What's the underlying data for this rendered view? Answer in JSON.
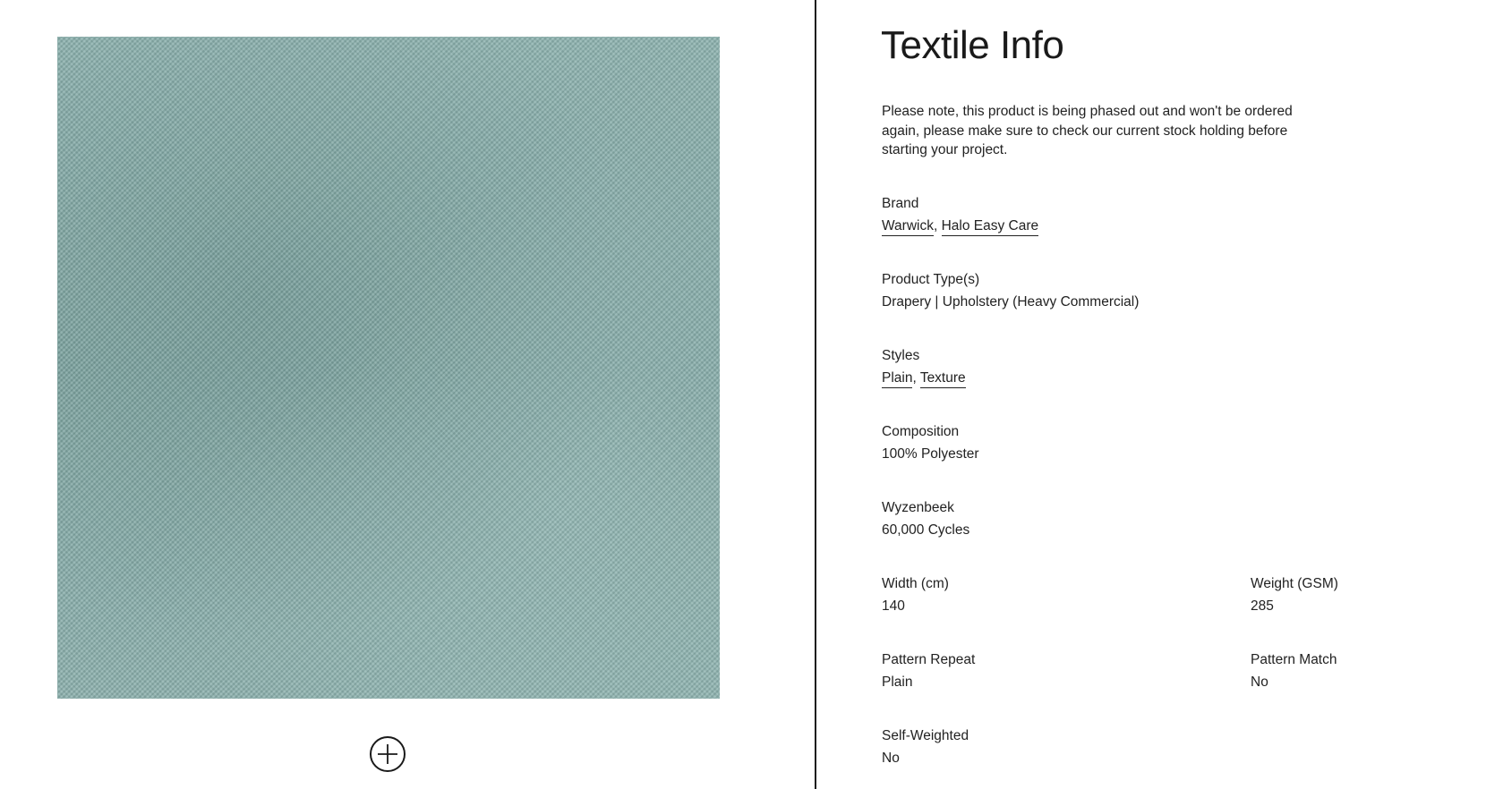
{
  "swatch": {
    "color": "#86aaa7"
  },
  "zoom": {
    "icon": "plus-circle-icon"
  },
  "info": {
    "title": "Textile Info",
    "notice": "Please note, this product is being phased out and won't be ordered again, please make sure to check our current stock holding before starting your project.",
    "brand": {
      "label": "Brand",
      "links": [
        "Warwick",
        "Halo Easy Care"
      ],
      "separator": ","
    },
    "product_types": {
      "label": "Product Type(s)",
      "value": "Drapery | Upholstery (Heavy Commercial)"
    },
    "styles": {
      "label": "Styles",
      "links": [
        "Plain",
        "Texture"
      ],
      "separator": ","
    },
    "composition": {
      "label": "Composition",
      "value": "100% Polyester"
    },
    "wyzenbeek": {
      "label": "Wyzenbeek",
      "value": "60,000 Cycles"
    },
    "width": {
      "label": "Width (cm)",
      "value": "140"
    },
    "weight": {
      "label": "Weight (GSM)",
      "value": "285"
    },
    "pattern_repeat": {
      "label": "Pattern Repeat",
      "value": "Plain"
    },
    "pattern_match": {
      "label": "Pattern Match",
      "value": "No"
    },
    "self_weighted": {
      "label": "Self-Weighted",
      "value": "No"
    }
  }
}
